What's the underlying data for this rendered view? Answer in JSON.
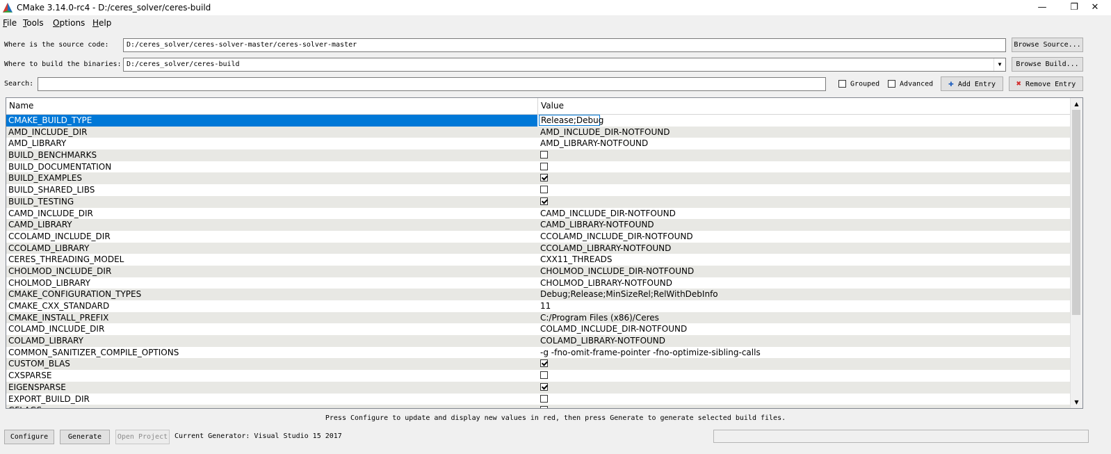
{
  "window": {
    "title": "CMake 3.14.0-rc4 - D:/ceres_solver/ceres-build",
    "minimize": "—",
    "maximize": "❐",
    "close": "✕"
  },
  "menu": [
    {
      "accel": "F",
      "rest": "ile"
    },
    {
      "accel": "T",
      "rest": "ools"
    },
    {
      "accel": "O",
      "rest": "ptions"
    },
    {
      "accel": "H",
      "rest": "elp"
    }
  ],
  "source": {
    "label": "Where is the source code:",
    "value": "D:/ceres_solver/ceres-solver-master/ceres-solver-master",
    "button": "Browse Source..."
  },
  "build": {
    "label": "Where to build the binaries:",
    "value": "D:/ceres_solver/ceres-build",
    "button": "Browse Build..."
  },
  "search": {
    "label": "Search:",
    "value": "",
    "grouped_label": "Grouped",
    "advanced_label": "Advanced",
    "add_entry": "Add Entry",
    "remove_entry": "Remove Entry"
  },
  "table": {
    "columns": [
      "Name",
      "Value"
    ],
    "rows": [
      {
        "name": "CMAKE_BUILD_TYPE",
        "value": "Release;Debug",
        "type": "edit",
        "selected": true
      },
      {
        "name": "AMD_INCLUDE_DIR",
        "value": "AMD_INCLUDE_DIR-NOTFOUND",
        "type": "text"
      },
      {
        "name": "AMD_LIBRARY",
        "value": "AMD_LIBRARY-NOTFOUND",
        "type": "text"
      },
      {
        "name": "BUILD_BENCHMARKS",
        "checked": false,
        "type": "bool"
      },
      {
        "name": "BUILD_DOCUMENTATION",
        "checked": false,
        "type": "bool"
      },
      {
        "name": "BUILD_EXAMPLES",
        "checked": true,
        "type": "bool"
      },
      {
        "name": "BUILD_SHARED_LIBS",
        "checked": false,
        "type": "bool"
      },
      {
        "name": "BUILD_TESTING",
        "checked": true,
        "type": "bool"
      },
      {
        "name": "CAMD_INCLUDE_DIR",
        "value": "CAMD_INCLUDE_DIR-NOTFOUND",
        "type": "text"
      },
      {
        "name": "CAMD_LIBRARY",
        "value": "CAMD_LIBRARY-NOTFOUND",
        "type": "text"
      },
      {
        "name": "CCOLAMD_INCLUDE_DIR",
        "value": "CCOLAMD_INCLUDE_DIR-NOTFOUND",
        "type": "text"
      },
      {
        "name": "CCOLAMD_LIBRARY",
        "value": "CCOLAMD_LIBRARY-NOTFOUND",
        "type": "text"
      },
      {
        "name": "CERES_THREADING_MODEL",
        "value": "CXX11_THREADS",
        "type": "text"
      },
      {
        "name": "CHOLMOD_INCLUDE_DIR",
        "value": "CHOLMOD_INCLUDE_DIR-NOTFOUND",
        "type": "text"
      },
      {
        "name": "CHOLMOD_LIBRARY",
        "value": "CHOLMOD_LIBRARY-NOTFOUND",
        "type": "text"
      },
      {
        "name": "CMAKE_CONFIGURATION_TYPES",
        "value": "Debug;Release;MinSizeRel;RelWithDebInfo",
        "type": "text"
      },
      {
        "name": "CMAKE_CXX_STANDARD",
        "value": "11",
        "type": "text"
      },
      {
        "name": "CMAKE_INSTALL_PREFIX",
        "value": "C:/Program Files (x86)/Ceres",
        "type": "text"
      },
      {
        "name": "COLAMD_INCLUDE_DIR",
        "value": "COLAMD_INCLUDE_DIR-NOTFOUND",
        "type": "text"
      },
      {
        "name": "COLAMD_LIBRARY",
        "value": "COLAMD_LIBRARY-NOTFOUND",
        "type": "text"
      },
      {
        "name": "COMMON_SANITIZER_COMPILE_OPTIONS",
        "value": "-g -fno-omit-frame-pointer -fno-optimize-sibling-calls",
        "type": "text"
      },
      {
        "name": "CUSTOM_BLAS",
        "checked": true,
        "type": "bool"
      },
      {
        "name": "CXSPARSE",
        "checked": false,
        "type": "bool"
      },
      {
        "name": "EIGENSPARSE",
        "checked": true,
        "type": "bool"
      },
      {
        "name": "EXPORT_BUILD_DIR",
        "checked": false,
        "type": "bool"
      },
      {
        "name": "GFLAGS",
        "checked": false,
        "type": "bool"
      }
    ]
  },
  "hint": "Press Configure to update and display new values in red, then press Generate to generate selected build files.",
  "buttons": {
    "configure": "Configure",
    "generate": "Generate",
    "open_project": "Open Project"
  },
  "generator": "Current Generator: Visual Studio 15 2017",
  "colors": {
    "selection": "#0078d7",
    "alt_row": "#e8e8e4",
    "window_bg": "#f0f0f0"
  }
}
